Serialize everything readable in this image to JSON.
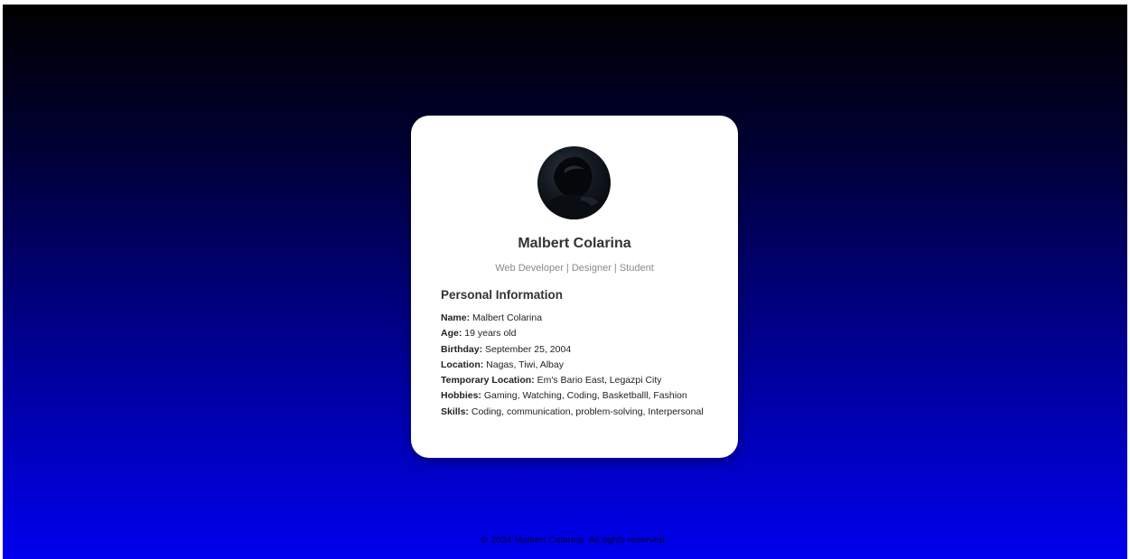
{
  "profile": {
    "name": "Malbert Colarina",
    "subtitle": "Web Developer | Designer | Student",
    "section_title": "Personal Information",
    "info": [
      {
        "label": "Name:",
        "value": "Malbert Colarina"
      },
      {
        "label": "Age:",
        "value": "19 years old"
      },
      {
        "label": "Birthday:",
        "value": "September 25, 2004"
      },
      {
        "label": "Location:",
        "value": "Nagas, Tiwi, Albay"
      },
      {
        "label": "Temporary Location:",
        "value": "Em's Bario East, Legazpi City"
      },
      {
        "label": "Hobbies:",
        "value": "Gaming, Watching, Coding, Basketballl, Fashion"
      },
      {
        "label": "Skills:",
        "value": "Coding, communication, problem-solving, Interpersonal"
      }
    ]
  },
  "footer": {
    "text": "© 2024 Malbert Colarina. All rights reserved."
  },
  "colors": {
    "background_top": "#000000",
    "background_bottom": "#0000ee",
    "card": "#ffffff",
    "heading": "#333333",
    "subtitle": "#8a8a8a"
  }
}
